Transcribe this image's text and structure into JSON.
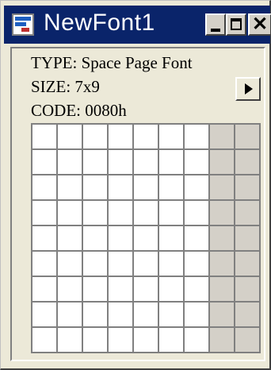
{
  "window": {
    "title": "NewFont1",
    "buttons": {
      "minimize": "minimize",
      "maximize": "maximize",
      "close": "close"
    },
    "close_glyph": "✕"
  },
  "font_info": {
    "type_line": "TYPE: Space Page Font",
    "size_line": "SIZE: 7x9",
    "code_line": "CODE: 0080h"
  },
  "glyph_grid": {
    "columns": 9,
    "rows": 9,
    "active_columns": 7,
    "cell_color": "#ffffff",
    "inactive_cell_color": "#d4d0c8",
    "grid_line_color": "#808080"
  },
  "colors": {
    "titlebar": "#0a246a",
    "face": "#ece9d8"
  },
  "icons": {
    "app": "font-editor-icon",
    "next": "play-right-icon"
  }
}
